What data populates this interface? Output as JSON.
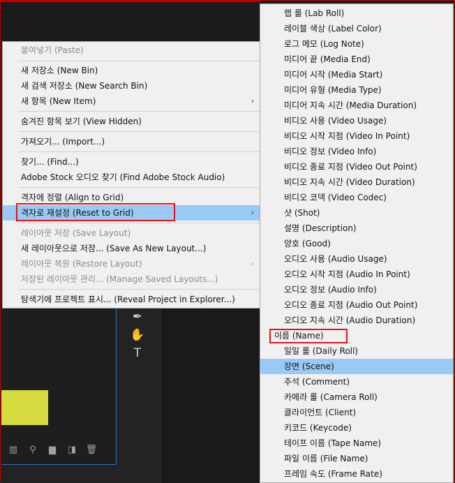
{
  "context_menu": {
    "items": [
      {
        "label": "붙여넣기 (Paste)",
        "disabled": true
      },
      {
        "label": "새 저장소 (New Bin)"
      },
      {
        "label": "새 검색 저장소 (New Search Bin)"
      },
      {
        "label": "새 항목 (New Item)",
        "submenu": true
      },
      {
        "label": "숨겨진 항목 보기 (View Hidden)"
      },
      {
        "label": "가져오기... (Import...)"
      },
      {
        "label": "찾기... (Find...)"
      },
      {
        "label": "Adobe Stock 오디오 찾기 (Find Adobe Stock Audio)"
      },
      {
        "label": "격자에 정렬 (Align to Grid)"
      },
      {
        "label": "격자로 재설정 (Reset to Grid)",
        "submenu": true,
        "highlighted": true
      },
      {
        "label": "레이아웃 저장 (Save Layout)",
        "disabled": true
      },
      {
        "label": "새 레이아웃으로 저장... (Save As New Layout...)"
      },
      {
        "label": "레이아웃 복원 (Restore Layout)",
        "disabled": true,
        "submenu": true
      },
      {
        "label": "저장된 레이아웃 관리... (Manage Saved Layouts...)",
        "disabled": true
      },
      {
        "label": "탐색기에 프로젝트 표시... (Reveal Project in Explorer...)"
      }
    ],
    "submenu_arrow": "›"
  },
  "submenu": {
    "items": [
      {
        "label": "랩 롤 (Lab Roll)"
      },
      {
        "label": "레이블 색상 (Label Color)"
      },
      {
        "label": "로그 메모 (Log Note)"
      },
      {
        "label": "미디어 끝 (Media End)"
      },
      {
        "label": "미디어 시작 (Media Start)"
      },
      {
        "label": "미디어 유형 (Media Type)"
      },
      {
        "label": "미디어 지속 시간 (Media Duration)"
      },
      {
        "label": "비디오 사용 (Video Usage)"
      },
      {
        "label": "비디오 시작 지점 (Video In Point)"
      },
      {
        "label": "비디오 정보 (Video Info)"
      },
      {
        "label": "비디오 종료 지점 (Video Out Point)"
      },
      {
        "label": "비디오 지속 시간 (Video Duration)"
      },
      {
        "label": "비디오 코덱 (Video Codec)"
      },
      {
        "label": "샷 (Shot)"
      },
      {
        "label": "설명 (Description)"
      },
      {
        "label": "양호 (Good)"
      },
      {
        "label": "오디오 사용 (Audio Usage)"
      },
      {
        "label": "오디오 시작 지점 (Audio In Point)"
      },
      {
        "label": "오디오 정보 (Audio Info)"
      },
      {
        "label": "오디오 종료 지점 (Audio Out Point)"
      },
      {
        "label": "오디오 지속 시간 (Audio Duration)"
      },
      {
        "label": "이름 (Name)",
        "outlined": true
      },
      {
        "label": "일일 롤 (Daily Roll)"
      },
      {
        "label": "장면 (Scene)",
        "highlighted": true
      },
      {
        "label": "주석 (Comment)"
      },
      {
        "label": "카메라 롤 (Camera Roll)"
      },
      {
        "label": "클라이언트 (Client)"
      },
      {
        "label": "키코드 (Keycode)"
      },
      {
        "label": "테이프 이름 (Tape Name)"
      },
      {
        "label": "파일 이름 (File Name)"
      },
      {
        "label": "프레임 속도 (Frame Rate)"
      }
    ]
  },
  "tools": {
    "icons": [
      "pen-icon",
      "hand-icon",
      "type-tool-icon"
    ],
    "glyphs": [
      "✒",
      "✋",
      "T"
    ]
  },
  "bin_toolbar": {
    "icons": [
      "list-view-icon",
      "search-icon",
      "folder-icon",
      "new-item-icon",
      "trash-icon"
    ],
    "glyphs": [
      "▥",
      "⚲",
      "▆",
      "◨",
      "🗑"
    ]
  },
  "colors": {
    "highlight": "#99c9f5",
    "outline": "#e0141c",
    "thumbnail": "#d6dc3f"
  }
}
